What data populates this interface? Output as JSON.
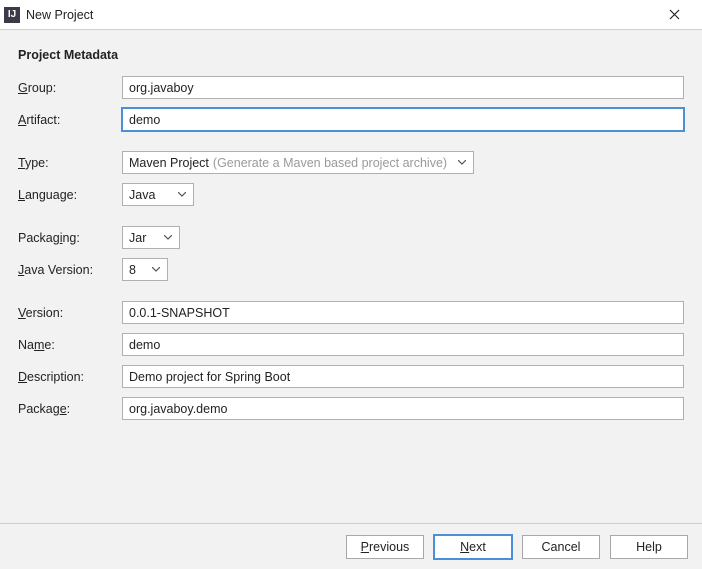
{
  "window": {
    "title": "New Project",
    "icon_letters": "IJ"
  },
  "section_title": "Project Metadata",
  "labels": {
    "group": "roup:",
    "group_mn": "G",
    "artifact": "rtifact:",
    "artifact_mn": "A",
    "type": "ype:",
    "type_mn": "T",
    "language": "anguage:",
    "language_mn": "L",
    "packaging": "Packag",
    "packaging_mn": "i",
    "packaging_post": "ng:",
    "javaver_pre": "",
    "javaver_mn": "J",
    "javaver": "ava Version:",
    "version": "ersion:",
    "version_mn": "V",
    "name_pre": "Na",
    "name_mn": "m",
    "name_post": "e:",
    "desc_mn": "D",
    "desc": "escription:",
    "package_pre": "Packag",
    "package_mn": "e",
    "package_post": ":"
  },
  "values": {
    "group": "org.javaboy",
    "artifact": "demo",
    "type_selected": "Maven Project",
    "type_hint": "(Generate a Maven based project archive)",
    "language": "Java",
    "packaging": "Jar",
    "java_version": "8",
    "version": "0.0.1-SNAPSHOT",
    "name": "demo",
    "description": "Demo project for Spring Boot",
    "package": "org.javaboy.demo"
  },
  "buttons": {
    "previous": "Previous",
    "next": "Next",
    "cancel": "Cancel",
    "help": "Help"
  }
}
